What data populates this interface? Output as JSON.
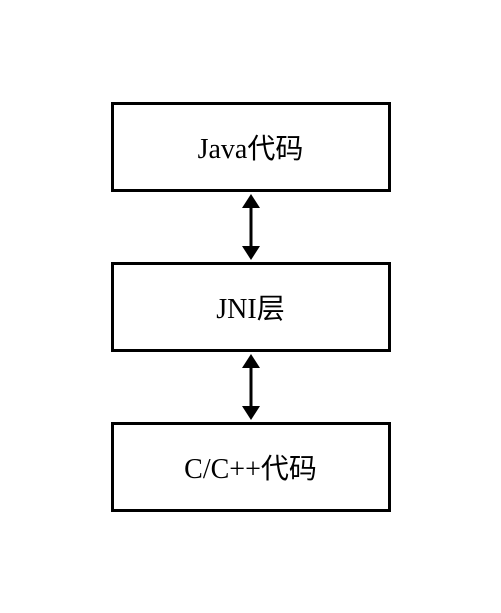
{
  "boxes": {
    "top": "Java代码",
    "middle": "JNI层",
    "bottom": "C/C++代码"
  }
}
